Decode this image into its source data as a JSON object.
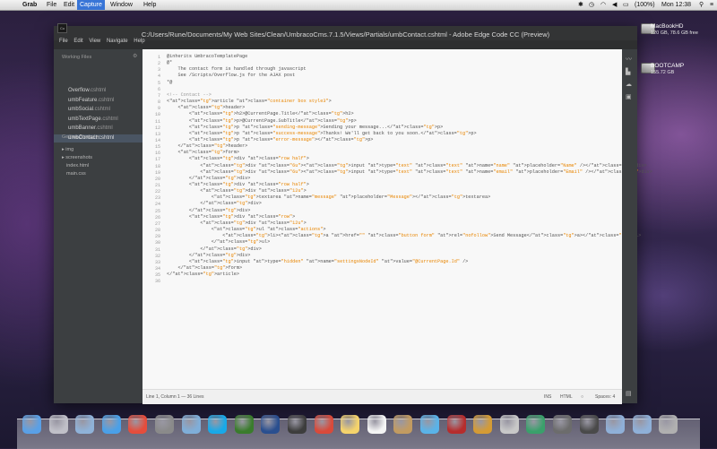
{
  "menubar": {
    "apple": "",
    "items": [
      "Grab",
      "File",
      "Edit",
      "Capture",
      "Window",
      "Help"
    ],
    "battery": "(100%)",
    "clock": "Mon 12:38"
  },
  "desktop": {
    "drives": [
      {
        "name": "MacBookHD",
        "size": "120 GB, 78.6 GB free"
      },
      {
        "name": "BOOTCAMP",
        "size": "155.72 GB"
      }
    ]
  },
  "window": {
    "title": "C:/Users/Rune/Documents/My Web Sites/Clean/UmbracoCms.7.1.5/Views/Partials/umbContact.cshtml - Adobe Edge Code CC (Preview)",
    "app_icon": "Co",
    "menu": [
      "File",
      "Edit",
      "View",
      "Navigate",
      "Help"
    ]
  },
  "sidebar": {
    "working_files_label": "Working Files",
    "working_files": [
      {
        "name": "Overflow",
        "ext": ".cshtml"
      },
      {
        "name": "umbFeature",
        "ext": ".cshtml"
      },
      {
        "name": "umbSocial",
        "ext": ".cshtml"
      },
      {
        "name": "umbTextPage",
        "ext": ".cshtml"
      },
      {
        "name": "umbBanner",
        "ext": ".cshtml"
      },
      {
        "name": "umbContact",
        "ext": ".cshtml"
      }
    ],
    "project_label": "Getting Started",
    "tree": [
      "img",
      "screenshots",
      "index.html",
      "main.css"
    ]
  },
  "editor": {
    "line_count": 36,
    "lines": [
      "@inherits UmbracoTemplatePage",
      "@*",
      "    The contact form is handled through javascript",
      "    See /Scripts/Overflow.js for the AJAX post",
      "*@",
      "",
      "<!-- Contact -->",
      "<article class=\"container box style3\">",
      "    <header>",
      "        <h2>@CurrentPage.Title</h2>",
      "        <p>@CurrentPage.SubTitle</p>",
      "        <p class=\"sending-message\">Sending your message...</p>",
      "        <p class=\"success-message\">Thanks! We'll get back to you soon.</p>",
      "        <p class=\"error-message\"></p>",
      "    </header>",
      "    <form>",
      "        <div class=\"row half\">",
      "            <div class=\"6u\"><input type=\"text\" class=\"text\" name=\"name\" placeholder=\"Name\" /></div>",
      "            <div class=\"6u\"><input type=\"text\" class=\"text\" name=\"email\" placeholder=\"Email\" /></div>",
      "        </div>",
      "        <div class=\"row half\">",
      "            <div class=\"12u\">",
      "                <textarea name=\"message\" placeholder=\"Message\"></textarea>",
      "            </div>",
      "        </div>",
      "        <div class=\"row\">",
      "            <div class=\"12u\">",
      "                <ul class=\"actions\">",
      "                    <li><a href=\"\" class=\"button form\" rel=\"nofollow\">Send Message</a></li>",
      "                </ul>",
      "            </div>",
      "        </div>",
      "        <input type=\"hidden\" name=\"settingsNodeId\" value=\"@CurrentPage.Id\" />",
      "    </form>",
      "</article>",
      ""
    ]
  },
  "statusbar": {
    "position": "Line 1, Column 1 — 36 Lines",
    "mode": "INS",
    "language": "HTML",
    "spaces": "Spaces: 4"
  },
  "dock": {
    "apps": [
      "finder-icon",
      "launchpad-icon",
      "preview-icon",
      "safari-icon",
      "chrome-icon",
      "system-preferences-icon",
      "mail-icon",
      "skype-icon",
      "dreamweaver-icon",
      "photoshop-icon",
      "facetime-icon",
      "parallels-icon",
      "notes-icon",
      "calendar-icon",
      "address-book-icon",
      "itunes-icon",
      "photo-booth-icon",
      "iphoto-icon",
      "pdf-icon",
      "time-machine-icon",
      "grab-icon",
      "screen-icon",
      "folder-icon",
      "downloads-icon",
      "trash-icon"
    ]
  }
}
